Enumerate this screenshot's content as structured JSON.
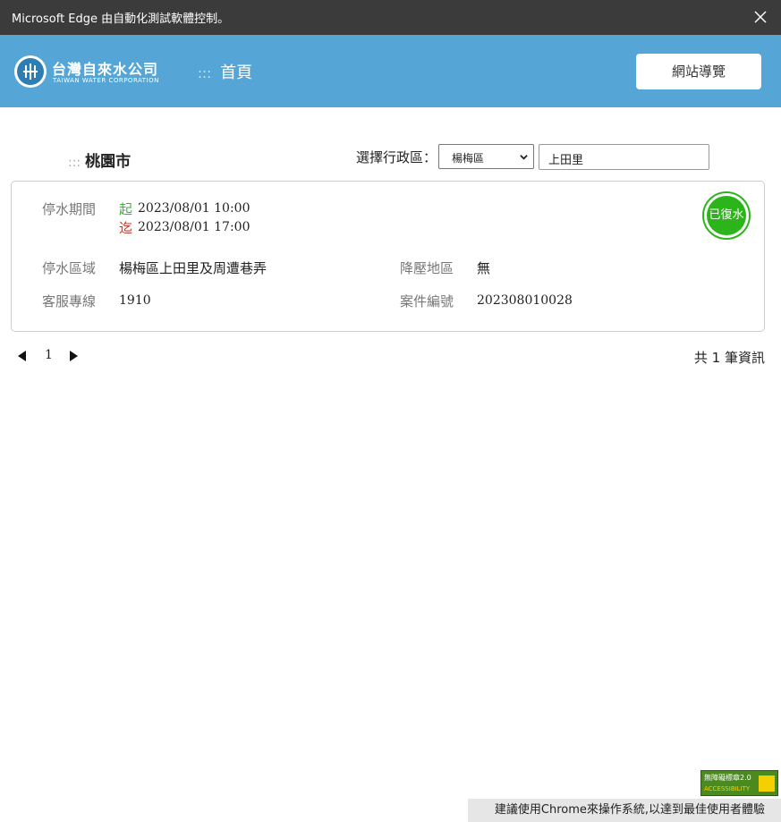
{
  "window": {
    "title": "Microsoft Edge 由自動化測試軟體控制。"
  },
  "header": {
    "logo_zh": "台灣自來水公司",
    "logo_en": "TAIWAN WATER CORPORATION",
    "breadcrumb_dots": ":::",
    "breadcrumb": "首頁",
    "sitemap_label": "網站導覽",
    "colors": {
      "header_bg": "#55a6d6",
      "titlebar_bg": "#3b3b3b"
    }
  },
  "filter": {
    "city_dots": ":::",
    "city": "桃園市",
    "area_label": "選擇行政區：",
    "area_selected": "楊梅區",
    "village_value": "上田里"
  },
  "notice": {
    "period_label": "停水期間",
    "start_marker": "起",
    "start_time": "2023/08/01  10:00",
    "end_marker": "迄",
    "end_time": "2023/08/01  17:00",
    "status": "已復水",
    "status_color": "#2cb51a",
    "area_label": "停水區域",
    "area_value": "楊梅區上田里及周遭巷弄",
    "pressure_label": "降壓地區",
    "pressure_value": "無",
    "hotline_label": "客服專線",
    "hotline_value": "1910",
    "case_label": "案件編號",
    "case_value": "202308010028"
  },
  "pagination": {
    "current_page": "1",
    "total_text": "共 1 筆資訊"
  },
  "footer": {
    "accessibility_label": "無障礙標章2.0",
    "accessibility_sub": "ACCESSIBILITY",
    "note": "建議使用Chrome來操作系統,以達到最佳使用者體驗"
  }
}
